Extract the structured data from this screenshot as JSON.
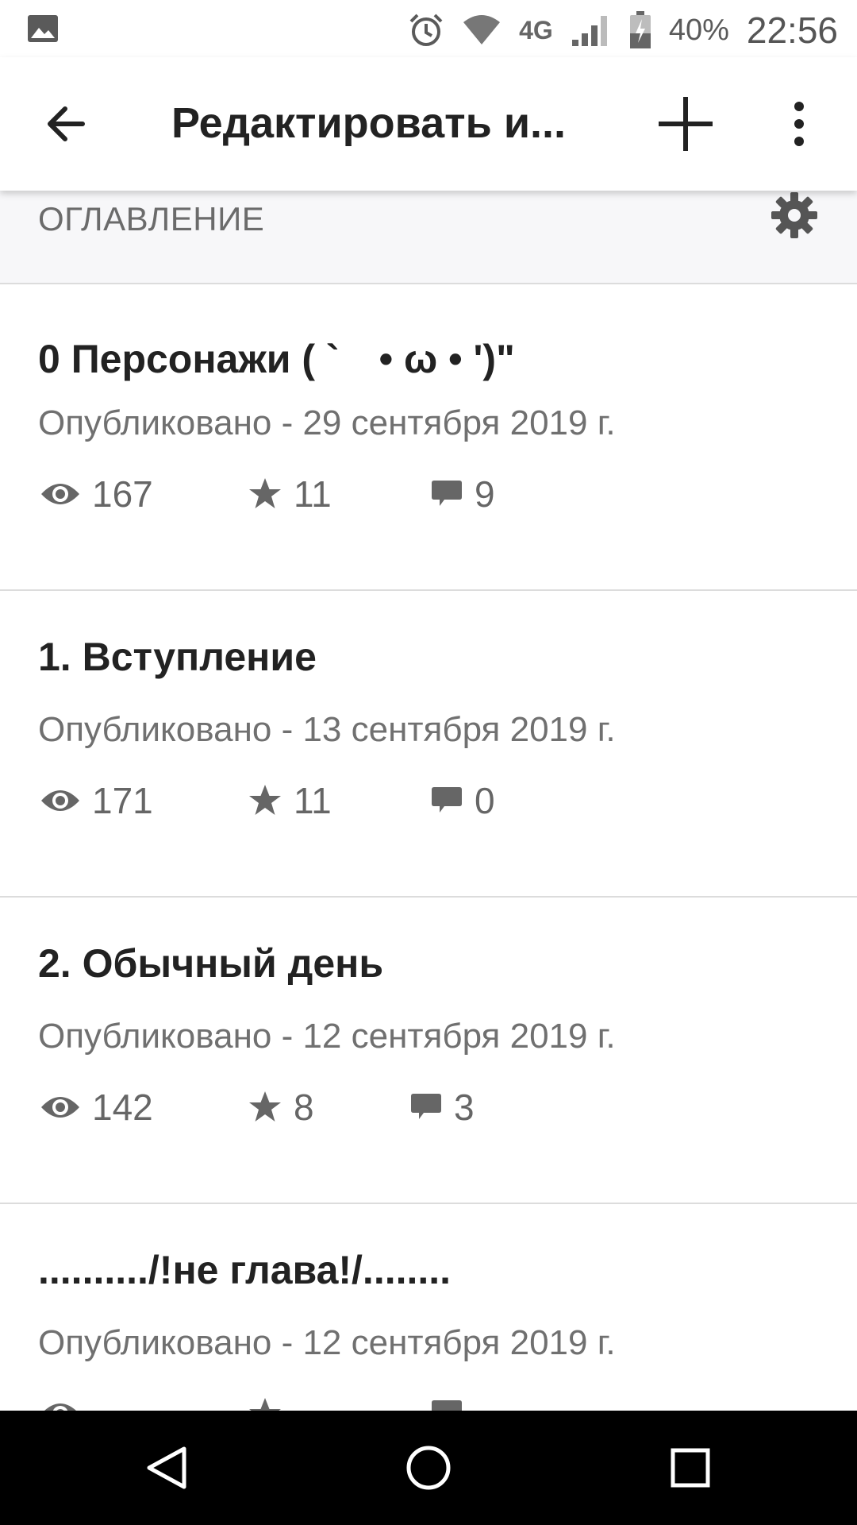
{
  "status_bar": {
    "battery": "40%",
    "time": "22:56",
    "network": "4G",
    "icons": [
      "gallery-icon",
      "alarm-icon",
      "wifi-icon",
      "signal-icon",
      "battery-icon"
    ]
  },
  "app_bar": {
    "title": "Редактировать и...",
    "icons": [
      "back-arrow-icon",
      "plus-icon",
      "more-vert-icon"
    ]
  },
  "section": {
    "label": "ОГЛАВЛЕНИЕ",
    "icon": "gear-icon"
  },
  "chapters": [
    {
      "title": "0 Персонажи ( `　• ω •  ')\"",
      "published": "Опубликовано - 29 сентября 2019 г.",
      "views": "167",
      "stars": "11",
      "comments": "9"
    },
    {
      "title": "1. Вступление",
      "published": "Опубликовано - 13 сентября 2019 г.",
      "views": "171",
      "stars": "11",
      "comments": "0"
    },
    {
      "title": "2. Обычный день",
      "published": "Опубликовано - 12 сентября 2019 г.",
      "views": "142",
      "stars": "8",
      "comments": "3"
    },
    {
      "title": "........../!не глава!/........",
      "published": "Опубликовано - 12 сентября 2019 г.",
      "views": "",
      "stars": "",
      "comments": ""
    }
  ],
  "colors": {
    "accent": "#222222",
    "muted": "#707070",
    "divider": "#dcdcdc",
    "navbar": "#000000"
  }
}
